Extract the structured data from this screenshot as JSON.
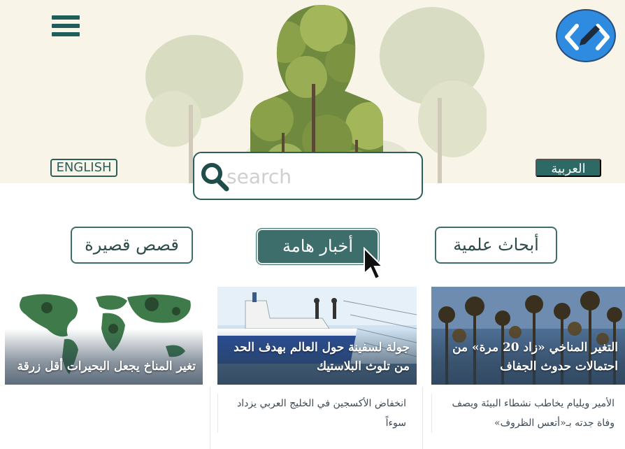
{
  "header": {
    "menu_icon": "hamburger-menu-icon",
    "logo_icon": "code-edit-icon",
    "logo_colors": {
      "fill": "#2f8be0",
      "border": "#2a4e7a"
    },
    "lang_en_label": "ENGLISH",
    "lang_ar_label": "العربية"
  },
  "search": {
    "placeholder": "search",
    "value": "",
    "icon": "search-icon"
  },
  "categories": [
    {
      "label": "قصص قصيرة",
      "active": false
    },
    {
      "label": "أخبار هامة",
      "active": true
    },
    {
      "label": "أبحاث علمية",
      "active": false
    }
  ],
  "articles": [
    {
      "title": "التغير المناخي «زاد 20 مرة» من احتمالات حدوث الجفاف"
    },
    {
      "title": "جولة لسفينة حول العالم بهدف الحد من تلوث البلاستيك"
    },
    {
      "title": "تغير المناخ يجعل البحيرات أقل زرقة"
    }
  ],
  "secondary_articles": [
    {
      "title": "الأمير ويليام يخاطب نشطاء البيئة ويصف وفاة جدته بـ«أتعس الظروف»"
    },
    {
      "title": "انخفاض الأكسجين في الخليج العربي يزداد سوءاً"
    }
  ],
  "colors": {
    "accent": "#3d6e6c",
    "dark_accent": "#1f5e5a",
    "hero_bg": "#f8f4e8"
  }
}
